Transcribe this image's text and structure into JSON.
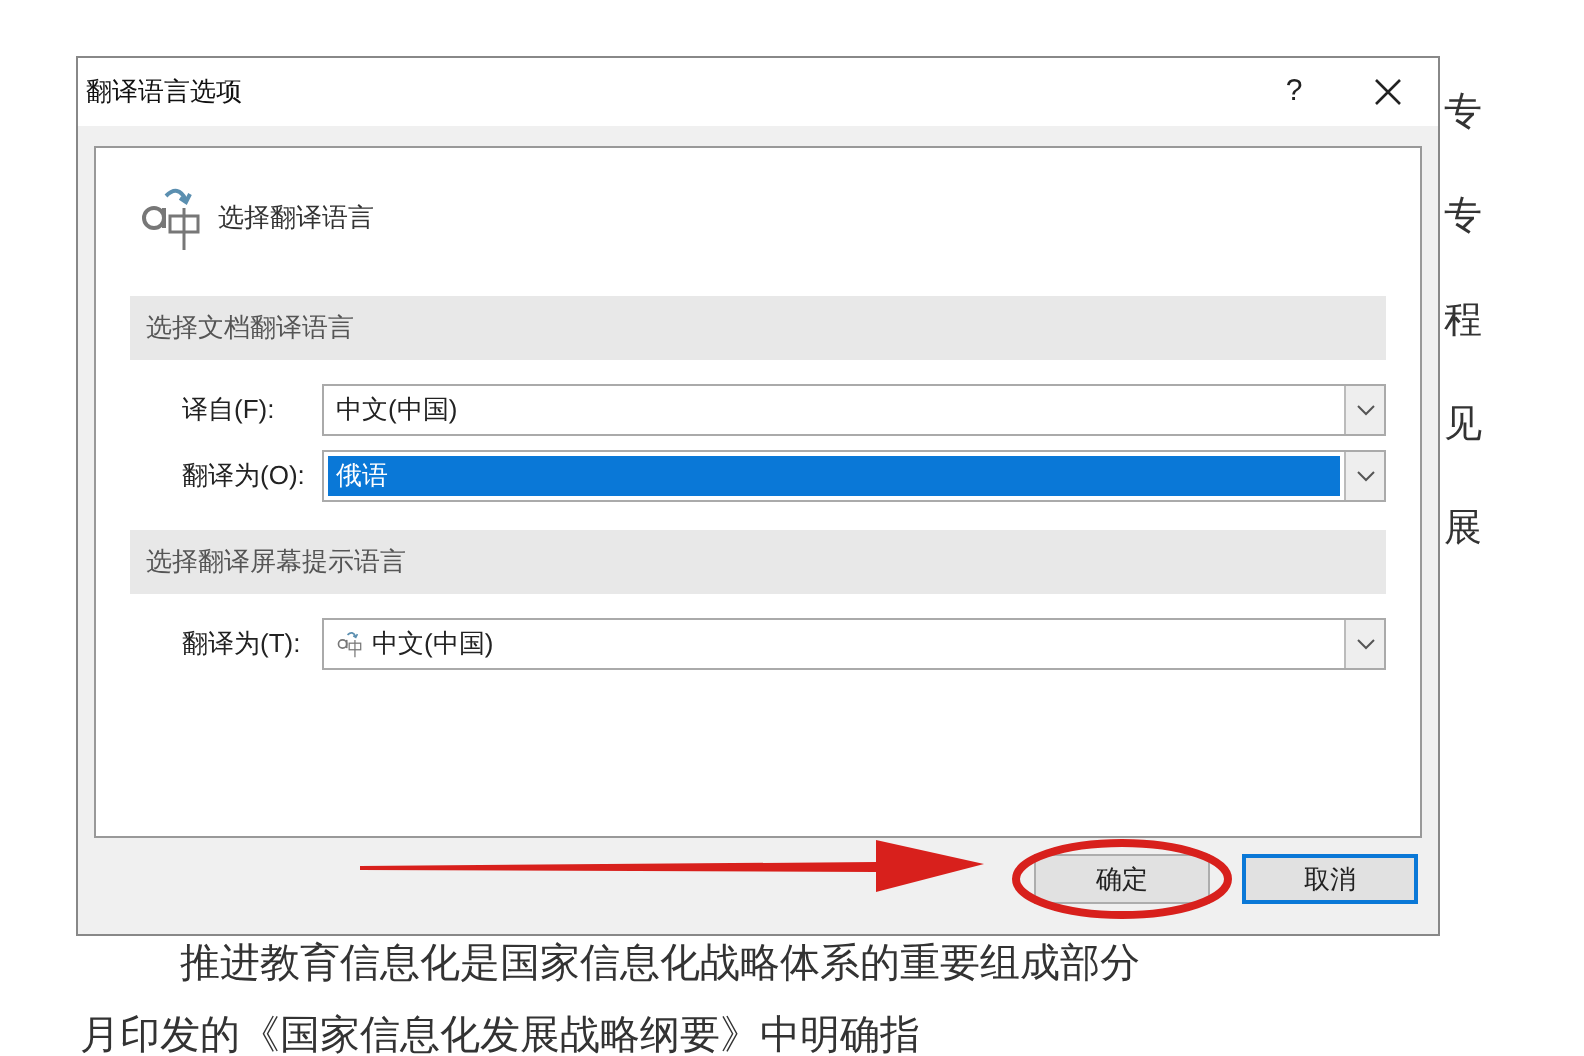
{
  "document": {
    "side_chars": [
      "专",
      "专",
      "程",
      "见",
      "展"
    ],
    "paragraph_lines": [
      "推进教育信息化是国家信息化战略体系的重要组成部分",
      "月印发的《国家信息化发展战略纲要》中明确指"
    ]
  },
  "dialog": {
    "title": "翻译语言选项",
    "help": "?",
    "heading": "选择翻译语言",
    "sections": [
      {
        "title": "选择文档翻译语言",
        "fields": [
          {
            "label": "译自(F):",
            "value": "中文(中国)",
            "highlighted": false,
            "kind": "plain"
          },
          {
            "label": "翻译为(O):",
            "value": "俄语",
            "highlighted": true,
            "kind": "plain"
          }
        ]
      },
      {
        "title": "选择翻译屏幕提示语言",
        "fields": [
          {
            "label": "翻译为(T):",
            "value": "中文(中国)",
            "highlighted": false,
            "kind": "icon"
          }
        ]
      }
    ],
    "buttons": [
      {
        "label": "确定",
        "focused": false,
        "circled": true
      },
      {
        "label": "取消",
        "focused": true,
        "circled": false
      }
    ]
  }
}
